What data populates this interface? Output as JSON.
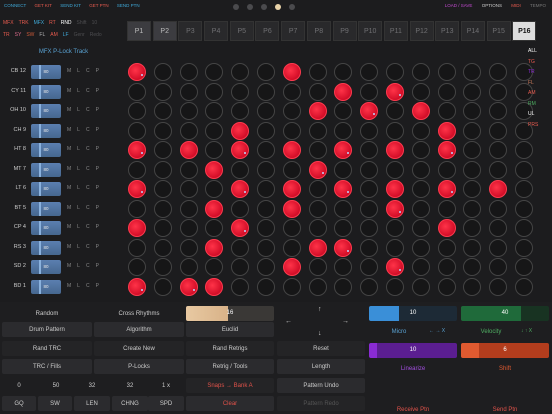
{
  "topbar": {
    "left_items": [
      {
        "label": "CONNECT",
        "color": "#3fa9d8"
      },
      {
        "label": "GET KIT",
        "color": "#e85b4f"
      },
      {
        "label": "SEND KIT",
        "color": "#3fa9d8"
      },
      {
        "label": "GET PTN",
        "color": "#e85b4f"
      },
      {
        "label": "SEND PTN",
        "color": "#3fa9d8"
      }
    ],
    "right_items": [
      {
        "label": "LOAD / SAVE",
        "color": "#c24ad0"
      },
      {
        "label": "OPTIONS",
        "color": "#cccccc"
      },
      {
        "label": "MIDI",
        "color": "#e85b4f"
      },
      {
        "label": "TEMPO",
        "color": "#777777"
      }
    ],
    "page_dots": 5,
    "active_dot": 3
  },
  "mode_panel": {
    "row1": [
      {
        "label": "MFX",
        "color": "#e85b4f"
      },
      {
        "label": "TRK",
        "color": "#e85b4f"
      },
      {
        "label": "MFX",
        "color": "#3fa9d8"
      },
      {
        "label": "RT",
        "color": "#e85b4f"
      },
      {
        "label": "RND",
        "color": "#ffffff"
      },
      {
        "label": "Shift",
        "color": "#4d4d50"
      },
      {
        "label": "10",
        "color": "#4d4d50"
      }
    ],
    "row2": [
      {
        "label": "TR",
        "color": "#e85b4f"
      },
      {
        "label": "SY",
        "color": "#d86a8a"
      },
      {
        "label": "SW",
        "color": "#cd5b39"
      },
      {
        "label": "FL",
        "color": "#b4b4b4"
      },
      {
        "label": "AM",
        "color": "#e85b4f"
      },
      {
        "label": "LF",
        "color": "#3fa9d8"
      },
      {
        "label": "Genr",
        "color": "#4d4d50"
      },
      {
        "label": "Redo",
        "color": "#4d4d50"
      }
    ]
  },
  "steps": [
    "P1",
    "P2",
    "P3",
    "P4",
    "P5",
    "P6",
    "P7",
    "P8",
    "P9",
    "P10",
    "P11",
    "P12",
    "P13",
    "P14",
    "P15",
    "P16"
  ],
  "track_title": "MFX P-Lock Track",
  "mlcp": [
    "M",
    "L",
    "C",
    "P"
  ],
  "tracks": [
    {
      "name": "CB 12",
      "vol": "80",
      "cells": [
        2,
        0,
        0,
        0,
        0,
        0,
        1,
        0,
        0,
        0,
        0,
        0,
        0,
        0,
        0,
        0
      ]
    },
    {
      "name": "CY 11",
      "vol": "80",
      "cells": [
        0,
        0,
        0,
        0,
        0,
        0,
        0,
        0,
        1,
        0,
        2,
        0,
        0,
        0,
        0,
        0
      ]
    },
    {
      "name": "OH 10",
      "vol": "80",
      "cells": [
        0,
        0,
        0,
        0,
        0,
        0,
        0,
        1,
        0,
        2,
        0,
        1,
        0,
        0,
        0,
        0
      ]
    },
    {
      "name": "CH 9",
      "vol": "80",
      "cells": [
        0,
        0,
        0,
        0,
        1,
        0,
        0,
        0,
        0,
        0,
        0,
        0,
        1,
        0,
        0,
        0
      ]
    },
    {
      "name": "HT 8",
      "vol": "80",
      "cells": [
        2,
        0,
        1,
        0,
        2,
        0,
        1,
        0,
        2,
        0,
        1,
        0,
        2,
        0,
        0,
        0
      ]
    },
    {
      "name": "MT 7",
      "vol": "80",
      "cells": [
        0,
        0,
        0,
        1,
        0,
        0,
        0,
        2,
        0,
        0,
        0,
        0,
        0,
        0,
        0,
        0
      ]
    },
    {
      "name": "LT 6",
      "vol": "80",
      "cells": [
        2,
        0,
        0,
        0,
        2,
        0,
        1,
        0,
        2,
        0,
        1,
        0,
        2,
        0,
        1,
        0
      ]
    },
    {
      "name": "BT 5",
      "vol": "80",
      "cells": [
        0,
        0,
        0,
        1,
        0,
        0,
        1,
        0,
        0,
        0,
        2,
        0,
        0,
        0,
        0,
        0
      ]
    },
    {
      "name": "CP 4",
      "vol": "80",
      "cells": [
        1,
        0,
        0,
        0,
        2,
        0,
        0,
        0,
        0,
        0,
        0,
        0,
        1,
        0,
        0,
        0
      ]
    },
    {
      "name": "RS 3",
      "vol": "80",
      "cells": [
        0,
        0,
        0,
        1,
        0,
        0,
        0,
        1,
        2,
        0,
        0,
        0,
        0,
        0,
        0,
        0
      ]
    },
    {
      "name": "SD 2",
      "vol": "80",
      "cells": [
        0,
        0,
        0,
        0,
        0,
        0,
        1,
        0,
        0,
        0,
        2,
        0,
        0,
        0,
        0,
        0
      ]
    },
    {
      "name": "BD 1",
      "vol": "80",
      "cells": [
        2,
        0,
        2,
        1,
        0,
        0,
        0,
        0,
        0,
        0,
        0,
        0,
        0,
        0,
        0,
        0
      ]
    }
  ],
  "legend": [
    {
      "label": "ALL",
      "color": "#ffffff"
    },
    {
      "label": "TG",
      "color": "#e85b4f"
    },
    {
      "label": "TR",
      "color": "#8b2bd4"
    },
    {
      "label": "FL",
      "color": "#c77a5a"
    },
    {
      "label": "AM",
      "color": "#e85b4f"
    },
    {
      "label": "RM",
      "color": "#4fae62"
    },
    {
      "label": "UL",
      "color": "#ffffff"
    },
    {
      "label": "PRS",
      "color": "#e85b4f"
    }
  ],
  "bottom": {
    "random": "Random",
    "cross_rhythms": "Cross Rhythms",
    "euclid_value": "16",
    "drum_pattern": "Drum Pattern",
    "algorithm": "Algorithm",
    "euclid": "Euclid",
    "rand_trc": "Rand TRC",
    "create_new": "Create New",
    "rand_retrigs": "Rand Retrigs",
    "reset": "Reset",
    "trc_fills": "TRC / Fills",
    "p_locks": "P-Locks",
    "retrig_tools": "Retrig / Tools",
    "length": "Length",
    "nums": [
      "0",
      "50",
      "32",
      "32",
      "1 x"
    ],
    "snaps": "Snaps → Bank A",
    "pattern_undo": "Pattern Undo",
    "bottom_labels": [
      "GQ",
      "SW",
      "LEN",
      "CHNG",
      "SPD"
    ],
    "clear": "Clear",
    "pattern_redo": "Pattern Redo",
    "micro_value": "10",
    "micro": "Micro",
    "velocity_value": "40",
    "velocity": "Velocity",
    "linearize_value": "10",
    "linearize": "Linearize",
    "shift_value": "6",
    "shift": "Shift",
    "receive": "Receive Ptn",
    "send": "Send Ptn",
    "micro_arrows": "← →  X",
    "velocity_arrows": "↓ ↑  X",
    "colors": {
      "micro": "#3a8fd8",
      "velocity": "#1f6a3a",
      "linearize": "#8a2bd4",
      "shift": "#d94a25",
      "euclid": "#e3c4a0",
      "snaps": "#e0524a",
      "clear": "#e0524a",
      "receive": "#e0524a",
      "send": "#e0524a"
    }
  }
}
